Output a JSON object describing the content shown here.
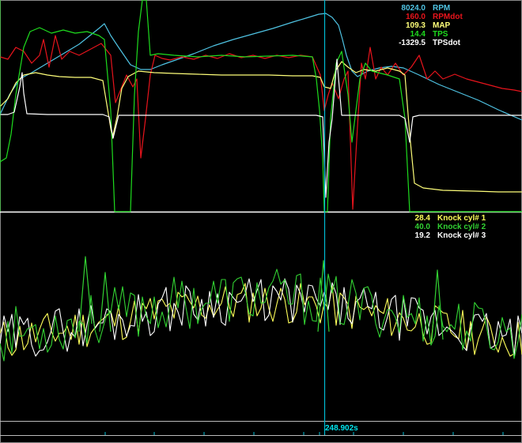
{
  "colors": {
    "background": "#000000",
    "cursor": "#00bcd4",
    "divider": "#ffffff",
    "rpm": "#4fc3e3",
    "rpmdot": "#e8141c",
    "map": "#ffff7a",
    "tps": "#1edc1e",
    "tpsdot": "#ffffff",
    "knock1": "#ffff5a",
    "knock2": "#32d232",
    "knock3": "#ffffff",
    "time": "#00e5ee"
  },
  "top_legend": [
    {
      "value": "8024.0",
      "label": "RPM",
      "color": "#4fc3e3"
    },
    {
      "value": "160.0",
      "label": "RPMdot",
      "color": "#e8141c"
    },
    {
      "value": "109.3",
      "label": "MAP",
      "color": "#ffff7a"
    },
    {
      "value": "14.4",
      "label": "TPS",
      "color": "#1edc1e"
    },
    {
      "value": "-1329.5",
      "label": "TPSdot",
      "color": "#ffffff"
    }
  ],
  "bottom_legend": [
    {
      "value": "28.4",
      "label": "Knock cyl# 1",
      "color": "#ffff5a"
    },
    {
      "value": "40.0",
      "label": "Knock cyl# 2",
      "color": "#32d232"
    },
    {
      "value": "19.2",
      "label": "Knock cyl# 3",
      "color": "#ffffff"
    }
  ],
  "cursor_time": "248.902s"
}
